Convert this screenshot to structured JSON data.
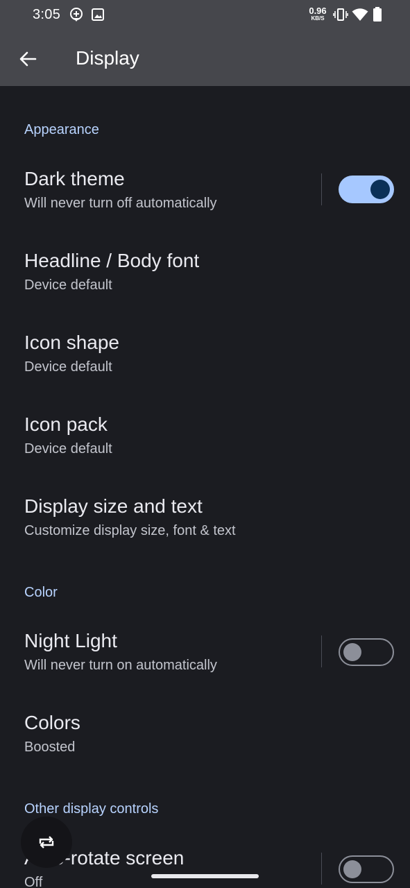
{
  "status_bar": {
    "time": "3:05",
    "net_speed_value": "0.96",
    "net_speed_unit": "KB/S",
    "icons": [
      "location-icon",
      "image-icon",
      "vibrate-icon",
      "wifi-icon",
      "battery-icon"
    ]
  },
  "app_bar": {
    "title": "Display",
    "back_icon": "arrow-back-icon"
  },
  "sections": {
    "appearance": "Appearance",
    "color": "Color",
    "other": "Other display controls"
  },
  "prefs": {
    "dark_theme": {
      "title": "Dark theme",
      "subtitle": "Will never turn off automatically",
      "enabled": true
    },
    "headline_font": {
      "title": "Headline / Body font",
      "subtitle": "Device default"
    },
    "icon_shape": {
      "title": "Icon shape",
      "subtitle": "Device default"
    },
    "icon_pack": {
      "title": "Icon pack",
      "subtitle": "Device default"
    },
    "display_size": {
      "title": "Display size and text",
      "subtitle": "Customize display size, font & text"
    },
    "night_light": {
      "title": "Night Light",
      "subtitle": "Will never turn on automatically",
      "enabled": false
    },
    "colors": {
      "title": "Colors",
      "subtitle": "Boosted"
    },
    "auto_rotate": {
      "title": "Auto-rotate screen",
      "subtitle": "Off",
      "enabled": false
    }
  },
  "fab": {
    "icon": "rotate-icon"
  },
  "colors": {
    "background": "#1b1c21",
    "app_bar": "#46474c",
    "accent": "#a6c8ff",
    "section_header": "#b8d3ff"
  }
}
